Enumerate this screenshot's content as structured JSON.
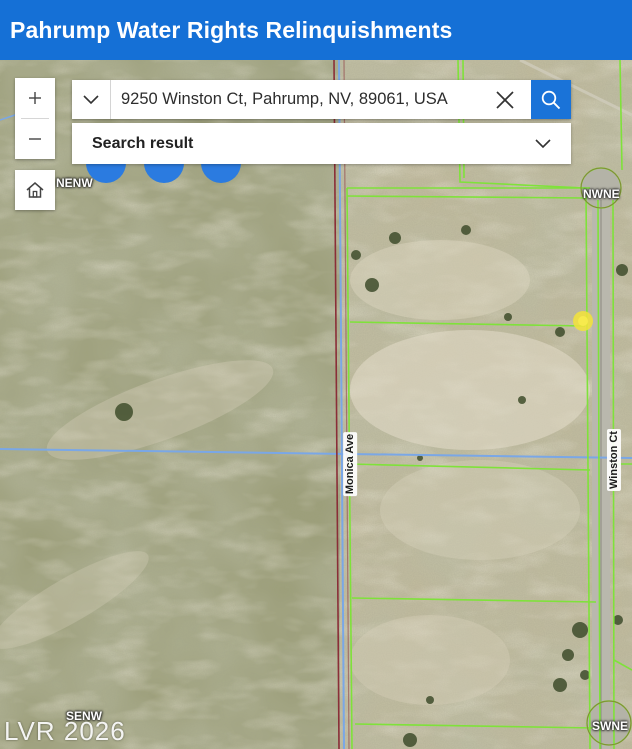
{
  "header": {
    "title": "Pahrump Water Rights Relinquishments"
  },
  "search": {
    "value": "9250 Winston Ct, Pahrump, NV, 89061, USA",
    "result_label": "Search result"
  },
  "map": {
    "road_labels": {
      "monica": "Monica Ave",
      "winston": "Winston Ct"
    },
    "parcel_labels": {
      "nenw": "NENW",
      "nwne": "NWNE",
      "senw": "SENW",
      "swne": "SWNE"
    },
    "colors": {
      "parcel_lines": "#7fe23a",
      "section_line": "#7aa7e6",
      "road_line": "#8a2e38",
      "result_marker": "#f3e33a",
      "header": "#1570d6"
    }
  },
  "watermark": "LVR 2026"
}
